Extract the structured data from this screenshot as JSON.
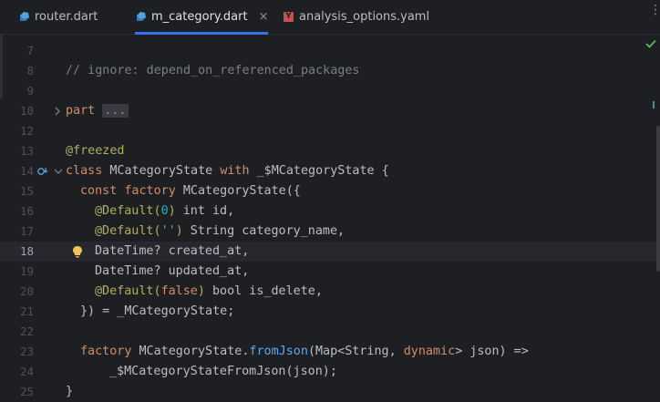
{
  "tabs": [
    {
      "label": "router.dart",
      "icon": "dart-icon",
      "active": false
    },
    {
      "label": "m_category.dart",
      "icon": "dart-icon",
      "active": true,
      "close": "×"
    },
    {
      "label": "analysis_options.yaml",
      "icon": "yaml-icon",
      "icon_text": "Y",
      "active": false
    }
  ],
  "menu_icon": "⋮",
  "current_line": "18",
  "lines": [
    {
      "n": "7"
    },
    {
      "n": "8",
      "comment": "// ignore: depend_on_referenced_packages"
    },
    {
      "n": "9"
    },
    {
      "n": "10",
      "kw": "part",
      "folded": "..."
    },
    {
      "n": "11"
    },
    {
      "n": "12"
    },
    {
      "n": "13",
      "ann": "@freezed"
    },
    {
      "n": "14",
      "p1": "class",
      "p2": " MCategoryState ",
      "p3": "with",
      "p4": " _$MCategoryState {"
    },
    {
      "n": "15",
      "p1": "const",
      "p2": " ",
      "p3": "factory",
      "p4": " MCategoryState({"
    },
    {
      "n": "16",
      "a": "@Default(",
      "v": "0",
      "b": ")",
      "rest": " int id,"
    },
    {
      "n": "17",
      "a": "@Default(",
      "v": "''",
      "b": ")",
      "rest": " String category_name,"
    },
    {
      "n": "18",
      "text": "DateTime? created_at,"
    },
    {
      "n": "19",
      "text": "DateTime? updated_at,"
    },
    {
      "n": "20",
      "a": "@Default(",
      "v": "false",
      "b": ")",
      "rest": " bool is_delete,"
    },
    {
      "n": "21",
      "text": "}) = _MCategoryState;"
    },
    {
      "n": "22"
    },
    {
      "n": "23",
      "kw": "factory",
      "t1": " MCategoryState.",
      "fn": "fromJson",
      "t2": "(Map<String, ",
      "kw2": "dynamic",
      "t3": "> json) =>"
    },
    {
      "n": "24",
      "text": "_$MCategoryStateFromJson(json);"
    },
    {
      "n": "25",
      "text": "}"
    }
  ],
  "colors": {
    "background": "#1e1f22",
    "keyword": "#cf8e6d",
    "annotation": "#b3ae60",
    "number": "#2aacb8",
    "string": "#6aab73",
    "function": "#57aaf7",
    "accent": "#3574f0"
  }
}
